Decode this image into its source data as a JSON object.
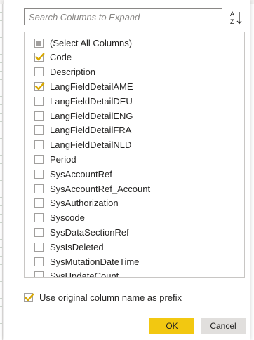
{
  "search": {
    "placeholder": "Search Columns to Expand",
    "value": ""
  },
  "sort_button": {
    "icon": "sort-az-icon"
  },
  "columns": [
    {
      "label": "(Select All Columns)",
      "state": "partial"
    },
    {
      "label": "Code",
      "state": "checked"
    },
    {
      "label": "Description",
      "state": "unchecked"
    },
    {
      "label": "LangFieldDetailAME",
      "state": "checked"
    },
    {
      "label": "LangFieldDetailDEU",
      "state": "unchecked"
    },
    {
      "label": "LangFieldDetailENG",
      "state": "unchecked"
    },
    {
      "label": "LangFieldDetailFRA",
      "state": "unchecked"
    },
    {
      "label": "LangFieldDetailNLD",
      "state": "unchecked"
    },
    {
      "label": "Period",
      "state": "unchecked"
    },
    {
      "label": "SysAccountRef",
      "state": "unchecked"
    },
    {
      "label": "SysAccountRef_Account",
      "state": "unchecked"
    },
    {
      "label": "SysAuthorization",
      "state": "unchecked"
    },
    {
      "label": "Syscode",
      "state": "unchecked"
    },
    {
      "label": "SysDataSectionRef",
      "state": "unchecked"
    },
    {
      "label": "SysIsDeleted",
      "state": "unchecked"
    },
    {
      "label": "SysMutationDateTime",
      "state": "unchecked"
    },
    {
      "label": "SysUpdateCount",
      "state": "unchecked"
    }
  ],
  "prefix_option": {
    "label": "Use original column name as prefix",
    "checked": true
  },
  "buttons": {
    "ok_label": "OK",
    "cancel_label": "Cancel"
  },
  "colors": {
    "accent": "#f2c811",
    "checkbox_border": "#a19f9d",
    "cancel_bg": "#e1dfdd"
  }
}
